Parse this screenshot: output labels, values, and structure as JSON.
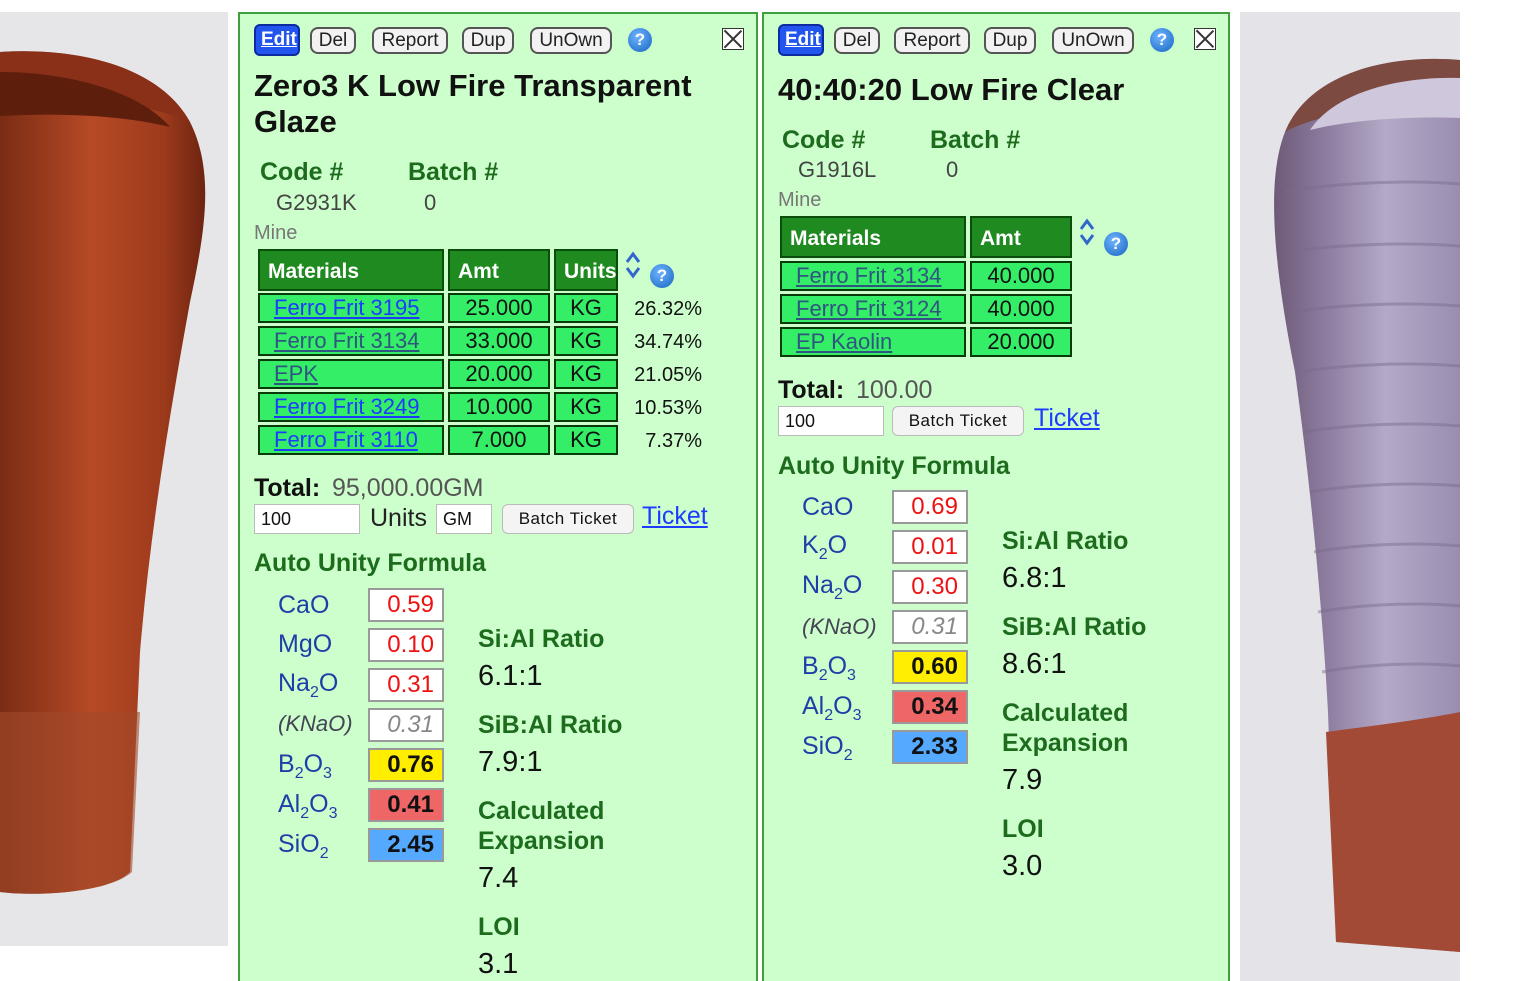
{
  "toolbar": {
    "edit": "Edit",
    "del": "Del",
    "report": "Report",
    "dup": "Dup",
    "unown": "UnOwn",
    "help": "?"
  },
  "labels": {
    "code": "Code #",
    "batch": "Batch #",
    "mine": "Mine",
    "col_materials": "Materials",
    "col_amt": "Amt",
    "col_units": "Units",
    "total": "Total:",
    "units": "Units",
    "batch_ticket": "Batch Ticket",
    "ticket": "Ticket",
    "auto_unity": "Auto Unity Formula",
    "si_al": "Si:Al Ratio",
    "sib_al": "SiB:Al Ratio",
    "calc_exp_1": "Calculated",
    "calc_exp_2": "Expansion",
    "loi": "LOI"
  },
  "oxide_names": {
    "CaO": "CaO",
    "MgO": "MgO",
    "Na2O": "Na2O",
    "K2O": "K2O",
    "KNaO": "(KNaO)",
    "B2O3": "B2O3",
    "Al2O3": "Al2O3",
    "SiO2": "SiO2"
  },
  "colors": {
    "panel_bg": "#ccffcc",
    "header_green": "#1f8a1f",
    "cell_green": "#33ee66",
    "b2o3": "#ffee00",
    "al2o3": "#ee6666",
    "sio2": "#55aaff",
    "link": "#1e3cff"
  },
  "recipe1": {
    "title_line1": "Zero3 K Low Fire Transparent",
    "title_line2": "Glaze",
    "code": "G2931K",
    "batch": "0",
    "materials": [
      {
        "name": "Ferro Frit 3195",
        "amt": "25.000",
        "units": "KG",
        "pct": "26.32%"
      },
      {
        "name": "Ferro Frit 3134",
        "amt": "33.000",
        "units": "KG",
        "pct": "34.74%"
      },
      {
        "name": "EPK",
        "amt": "20.000",
        "units": "KG",
        "pct": "21.05%"
      },
      {
        "name": "Ferro Frit 3249",
        "amt": "10.000",
        "units": "KG",
        "pct": "10.53%"
      },
      {
        "name": "Ferro Frit 3110",
        "amt": "7.000",
        "units": "KG",
        "pct": "7.37%"
      }
    ],
    "total": "95,000.00GM",
    "batch_input": "100",
    "units_input": "GM",
    "oxides": {
      "CaO": "0.59",
      "MgO": "0.10",
      "Na2O": "0.31",
      "KNaO": "0.31",
      "B2O3": "0.76",
      "Al2O3": "0.41",
      "SiO2": "2.45"
    },
    "si_al": "6.1:1",
    "sib_al": "7.9:1",
    "expansion": "7.4",
    "loi": "3.1"
  },
  "recipe2": {
    "title": "40:40:20 Low Fire Clear",
    "code": "G1916L",
    "batch": "0",
    "materials": [
      {
        "name": "Ferro Frit 3134",
        "amt": "40.000"
      },
      {
        "name": "Ferro Frit 3124",
        "amt": "40.000"
      },
      {
        "name": "EP Kaolin",
        "amt": "20.000"
      }
    ],
    "total": "100.00",
    "batch_input": "100",
    "oxides": {
      "CaO": "0.69",
      "K2O": "0.01",
      "Na2O": "0.30",
      "KNaO": "0.31",
      "B2O3": "0.60",
      "Al2O3": "0.34",
      "SiO2": "2.33"
    },
    "si_al": "6.8:1",
    "sib_al": "8.6:1",
    "expansion": "7.9",
    "loi": "3.0"
  }
}
